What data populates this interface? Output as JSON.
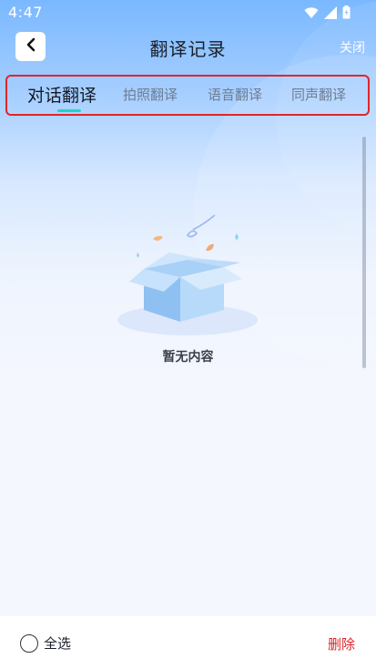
{
  "status_bar": {
    "time": "4:47",
    "icons": [
      "wifi-icon",
      "signal-icon",
      "battery-icon"
    ]
  },
  "header": {
    "back_icon": "chevron-left-icon",
    "title": "翻译记录",
    "close_label": "关闭"
  },
  "tabs": [
    {
      "label": "对话翻译",
      "active": true
    },
    {
      "label": "拍照翻译",
      "active": false
    },
    {
      "label": "语音翻译",
      "active": false
    },
    {
      "label": "同声翻译",
      "active": false
    }
  ],
  "empty_state": {
    "icon": "empty-box-icon",
    "text": "暂无内容"
  },
  "footer": {
    "select_all_label": "全选",
    "select_all_checked": false,
    "delete_label": "删除"
  },
  "colors": {
    "accent_underline": "#22d3c5",
    "delete": "#d8262b",
    "highlight_box": "#e0252b"
  }
}
